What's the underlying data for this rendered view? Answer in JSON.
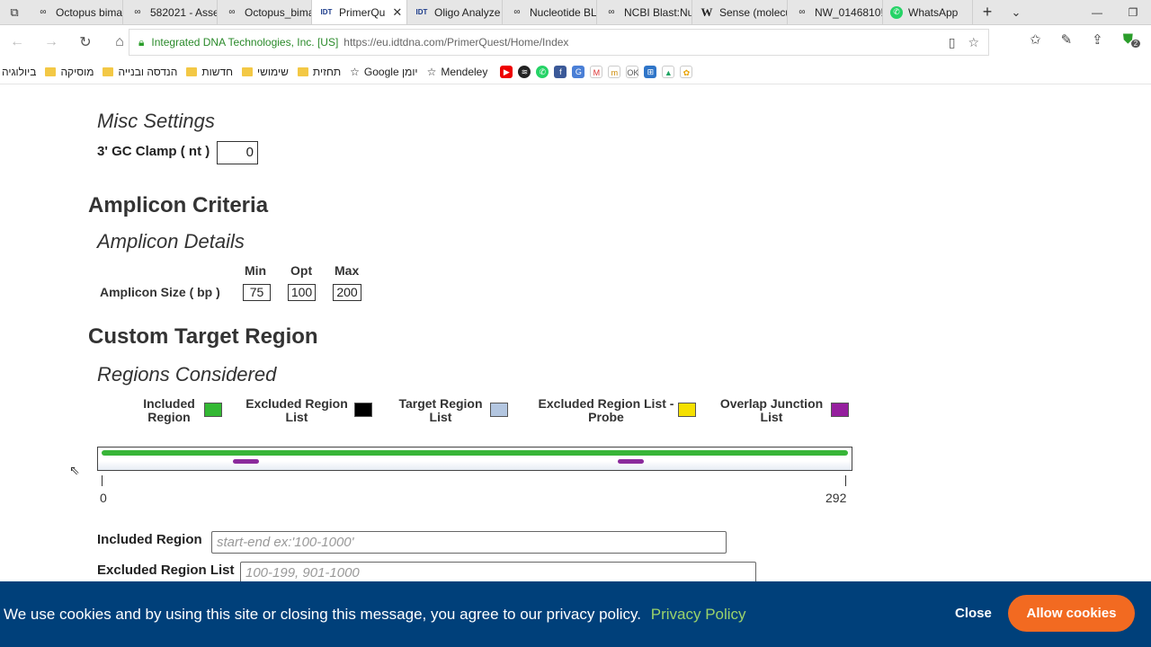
{
  "browser": {
    "tabs": [
      {
        "label": "Octopus bima",
        "icon": "link-icon"
      },
      {
        "label": "582021 - Asse",
        "icon": "link-icon"
      },
      {
        "label": "Octopus_bima",
        "icon": "link-icon"
      },
      {
        "label": "PrimerQu",
        "icon": "idt-icon",
        "active": true
      },
      {
        "label": "Oligo Analyze",
        "icon": "idt-icon"
      },
      {
        "label": "Nucleotide BL",
        "icon": "link-icon"
      },
      {
        "label": "NCBI Blast:Nu",
        "icon": "link-icon"
      },
      {
        "label": "Sense (molecu",
        "icon": "wikipedia-icon"
      },
      {
        "label": "NW_0146810!",
        "icon": "link-icon"
      },
      {
        "label": "WhatsApp",
        "icon": "whatsapp-icon"
      }
    ],
    "site_identity": "Integrated DNA Technologies, Inc. [US]",
    "url": "https://eu.idtdna.com/PrimerQuest/Home/Index",
    "bookmarks": [
      {
        "label": "ביולוגיה",
        "type": "folder"
      },
      {
        "label": "מוסיקה",
        "type": "folder"
      },
      {
        "label": "הנדסה ובנייה",
        "type": "folder"
      },
      {
        "label": "חדשות",
        "type": "folder"
      },
      {
        "label": "שימושי",
        "type": "folder"
      },
      {
        "label": "תחזית",
        "type": "folder"
      },
      {
        "label": "Google יומן",
        "type": "star"
      },
      {
        "label": "Mendeley",
        "type": "star"
      }
    ],
    "badge_count": "2"
  },
  "misc": {
    "heading": "Misc Settings",
    "gc_clamp_label": "3' GC Clamp ( nt )",
    "gc_clamp_value": "0"
  },
  "amplicon": {
    "heading": "Amplicon Criteria",
    "subheading": "Amplicon Details",
    "col_min": "Min",
    "col_opt": "Opt",
    "col_max": "Max",
    "size_label": "Amplicon Size ( bp )",
    "min": "75",
    "opt": "100",
    "max": "200"
  },
  "target": {
    "heading": "Custom Target Region",
    "subheading": "Regions Considered",
    "legend": [
      {
        "label": "Included Region",
        "color": "#33b833"
      },
      {
        "label": "Excluded Region List",
        "color": "#000000"
      },
      {
        "label": "Target Region List",
        "color": "#b3c6e0"
      },
      {
        "label": "Excluded Region List - Probe",
        "color": "#f5e000"
      },
      {
        "label": "Overlap Junction List",
        "color": "#951f9e"
      }
    ],
    "axis_start": "0",
    "axis_end": "292",
    "included_label": "Included Region",
    "included_placeholder": "start-end ex:'100-1000'",
    "excluded_label": "Excluded Region List",
    "excluded_placeholder": "100-199, 901-1000"
  },
  "cookie": {
    "text": "We use cookies and by using this site or closing this message, you agree to our privacy policy.",
    "link": "Privacy Policy",
    "close": "Close",
    "allow": "Allow cookies"
  }
}
